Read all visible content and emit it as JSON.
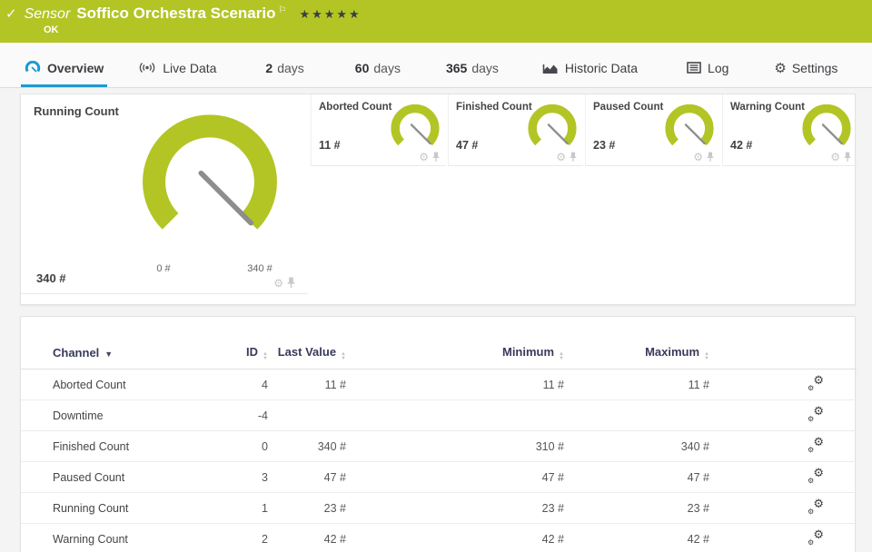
{
  "header": {
    "status_check": "✓",
    "kind_label": "Sensor",
    "title": "Soffico Orchestra Scenario",
    "flag": "⚐",
    "priority_stars": "★★★★★",
    "status": "OK"
  },
  "tabs": {
    "overview": "Overview",
    "live_data": "Live Data",
    "d2_num": "2",
    "d2_unit": "days",
    "d60_num": "60",
    "d60_unit": "days",
    "d365_num": "365",
    "d365_unit": "days",
    "historic": "Historic Data",
    "log": "Log",
    "settings": "Settings",
    "settings_gear": "⚙"
  },
  "colors": {
    "status_green": "#b2c525",
    "accent_blue": "#1b9ad2",
    "gauge_green": "#b2c525",
    "needle_gray": "#8d8d8d"
  },
  "gauges": {
    "main": {
      "title": "Running Count",
      "value": "340 #",
      "min_label": "0 #",
      "max_label": "340 #"
    },
    "small": [
      {
        "title": "Aborted Count",
        "value": "11 #"
      },
      {
        "title": "Finished Count",
        "value": "47 #"
      },
      {
        "title": "Paused Count",
        "value": "23 #"
      },
      {
        "title": "Warning Count",
        "value": "42 #"
      }
    ],
    "gear_glyph": "⚙"
  },
  "table": {
    "columns": {
      "channel": "Channel",
      "id": "ID",
      "last": "Last Value",
      "min": "Minimum",
      "max": "Maximum"
    },
    "rows": [
      {
        "channel": "Aborted Count",
        "id": "4",
        "last": "11 #",
        "min": "11 #",
        "max": "11 #"
      },
      {
        "channel": "Downtime",
        "id": "-4",
        "last": "",
        "min": "",
        "max": ""
      },
      {
        "channel": "Finished Count",
        "id": "0",
        "last": "340 #",
        "min": "310 #",
        "max": "340 #"
      },
      {
        "channel": "Paused Count",
        "id": "3",
        "last": "47 #",
        "min": "47 #",
        "max": "47 #"
      },
      {
        "channel": "Running Count",
        "id": "1",
        "last": "23 #",
        "min": "23 #",
        "max": "23 #"
      },
      {
        "channel": "Warning Count",
        "id": "2",
        "last": "42 #",
        "min": "42 #",
        "max": "42 #"
      }
    ],
    "gear_glyph": "⚙"
  }
}
